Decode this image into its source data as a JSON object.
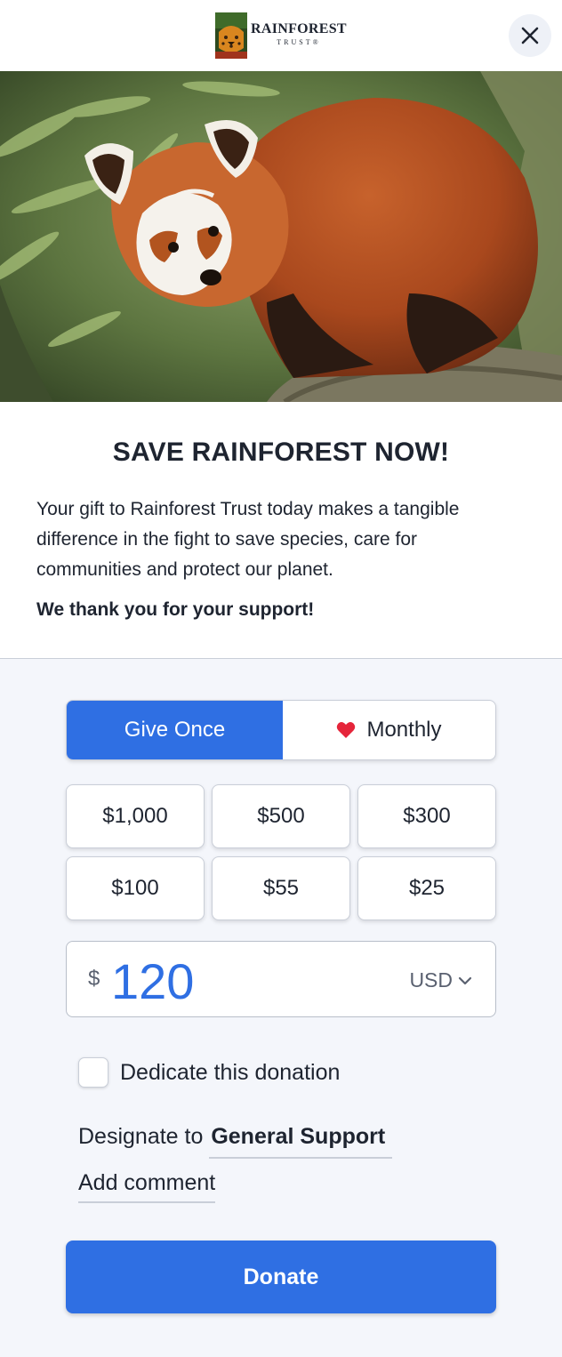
{
  "header": {
    "logo_title": "RAINFOREST",
    "logo_subtitle": "TRUST®",
    "close_icon": "close-icon"
  },
  "hero": {
    "subject": "red-panda-photo"
  },
  "intro": {
    "title": "SAVE RAINFOREST NOW!",
    "description": "Your gift to Rainforest Trust today makes a tangible difference in the fight to save species, care for communities and protect our planet.",
    "thanks": "We thank you for your support!"
  },
  "frequency": {
    "once_label": "Give Once",
    "monthly_label": "Monthly",
    "monthly_icon": "heart-icon",
    "selected": "Give Once"
  },
  "amounts": [
    "$1,000",
    "$500",
    "$300",
    "$100",
    "$55",
    "$25"
  ],
  "amount_field": {
    "currency_symbol": "$",
    "value": "120",
    "currency": "USD"
  },
  "dedicate": {
    "label": "Dedicate this donation",
    "checked": false
  },
  "designate": {
    "prefix": "Designate to",
    "value": "General Support"
  },
  "comment": {
    "label": "Add comment"
  },
  "donate": {
    "label": "Donate"
  },
  "colors": {
    "accent": "#2f6fe3",
    "background": "#f4f6fb",
    "text": "#1e2430",
    "heart": "#e5253a"
  }
}
